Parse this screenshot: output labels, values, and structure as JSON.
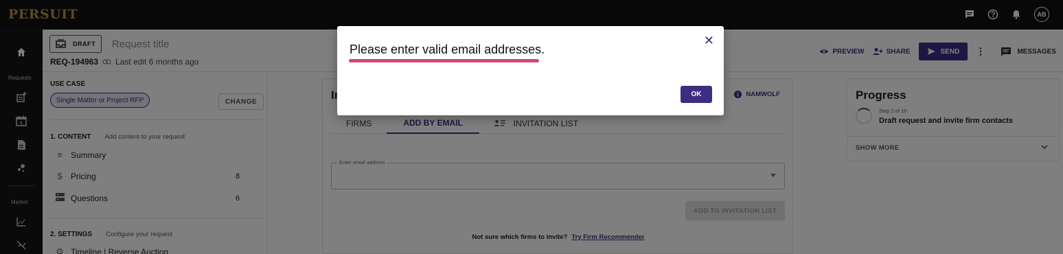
{
  "app": {
    "logo": "PERSUIT",
    "avatar_initials": "AB"
  },
  "nav": {
    "requests_label": "Requests",
    "market_label": "Market"
  },
  "header": {
    "status_badge": "DRAFT",
    "title": "Request title",
    "request_id": "REQ-194963",
    "last_edit": "Last edit 6 months ago",
    "preview_label": "PREVIEW",
    "share_label": "SHARE",
    "send_label": "SEND",
    "messages_label": "MESSAGES"
  },
  "left_panel": {
    "use_case_title": "USE CASE",
    "use_case_value": "Single Matter or Project RFP",
    "change_label": "CHANGE",
    "content_title": "1. CONTENT",
    "content_subtitle": "Add content to your request",
    "content_items": [
      {
        "label": "Summary",
        "count": "",
        "icon": "lines-icon"
      },
      {
        "label": "Pricing",
        "count": "8",
        "icon": "dollar-icon"
      },
      {
        "label": "Questions",
        "count": "6",
        "icon": "questions-icon"
      }
    ],
    "settings_title": "2. SETTINGS",
    "settings_subtitle": "Configure your request",
    "settings_items": [
      {
        "label": "Timeline | Reverse Auction",
        "icon": "gear-icon"
      }
    ]
  },
  "main": {
    "title_partial": "In",
    "namwolf_label": "NAMWOLF",
    "tabs": [
      {
        "label": "FIRMS"
      },
      {
        "label": "ADD BY EMAIL"
      },
      {
        "label": "INVITATION LIST"
      }
    ],
    "email_label": "Enter email address",
    "email_value": "",
    "add_button": "ADD TO INVITATION LIST",
    "recommender_text": "Not sure which firms to invite?",
    "recommender_link": "Try Firm Recommender"
  },
  "progress": {
    "title": "Progress",
    "step": "Step 2 of 10",
    "description": "Draft request and invite firm contacts",
    "show_more": "SHOW MORE"
  },
  "modal": {
    "message": "Please enter valid email addresses.",
    "ok_label": "OK"
  },
  "colors": {
    "brand": "#3f2d82",
    "logo_gold": "#b8924b",
    "highlight": "#d6457a"
  }
}
